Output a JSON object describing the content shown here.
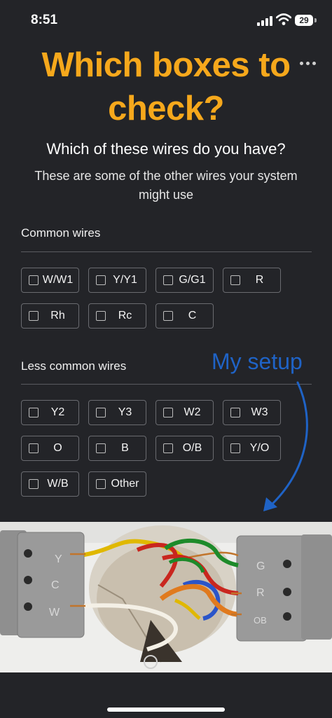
{
  "status_bar": {
    "time": "8:51",
    "battery": "29"
  },
  "header": {
    "title_line1": "Which boxes to",
    "title_line2": "check?"
  },
  "question": "Which of these wires do you have?",
  "subtitle": "These are some of the other wires your system might use",
  "common_wires": {
    "label": "Common wires",
    "options": [
      "W/W1",
      "Y/Y1",
      "G/G1",
      "R",
      "Rh",
      "Rc",
      "C"
    ]
  },
  "less_common_wires": {
    "label": "Less common wires",
    "options": [
      "Y2",
      "Y3",
      "W2",
      "W3",
      "O",
      "B",
      "O/B",
      "Y/O",
      "W/B",
      "Other"
    ]
  },
  "annotation": "My setup",
  "photo": {
    "left_terminal_labels": [
      "Y",
      "C",
      "W"
    ],
    "right_terminal_labels": [
      "G",
      "R",
      "OB"
    ]
  },
  "colors": {
    "accent": "#f6a81c",
    "background": "#232428",
    "annotation": "#1f63c6"
  },
  "icons": [
    "signal-icon",
    "wifi-icon",
    "battery-icon",
    "more-icon",
    "checkbox-icon",
    "arrow-icon"
  ]
}
